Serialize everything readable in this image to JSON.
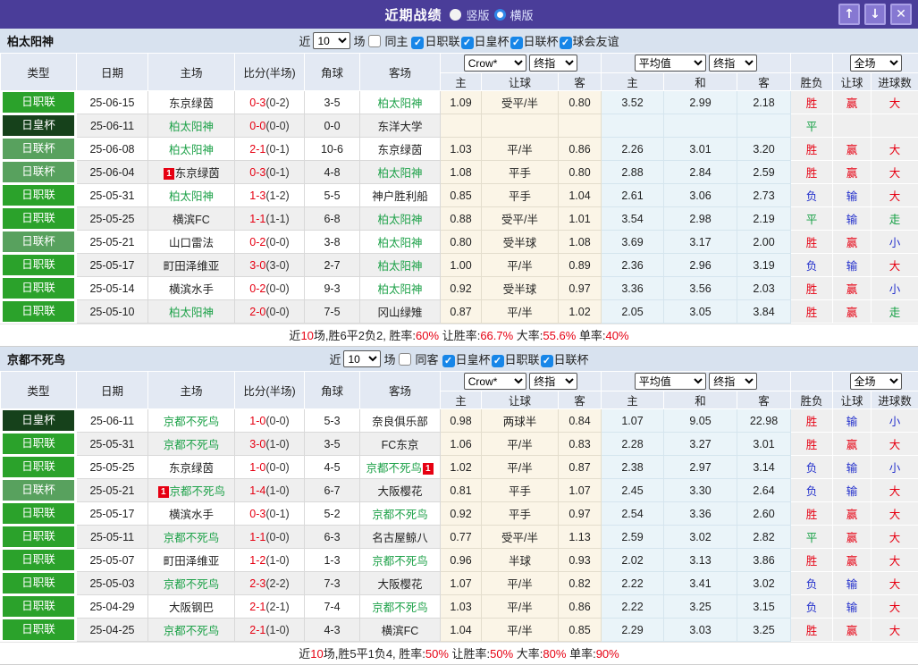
{
  "titlebar": {
    "title": "近期战绩",
    "radios": [
      {
        "label": "竖版",
        "selected": false
      },
      {
        "label": "横版",
        "selected": true
      }
    ],
    "buttons": [
      {
        "name": "scroll-up",
        "glyph": "↑"
      },
      {
        "name": "scroll-down",
        "glyph": "↓"
      },
      {
        "name": "close",
        "glyph": "✕"
      }
    ]
  },
  "table_header": {
    "main": [
      "类型",
      "日期",
      "主场",
      "比分(半场)",
      "角球",
      "客场"
    ],
    "sub": [
      "主",
      "让球",
      "客",
      "主",
      "和",
      "客",
      "胜负",
      "让球",
      "进球数"
    ],
    "selects": {
      "company": "Crow*",
      "company_time": "终指",
      "average": "平均值",
      "average_time": "终指",
      "fulltime": "全场"
    }
  },
  "colors": {
    "titlebar_bg": "#4a3d99",
    "red": "#e60012",
    "blue": "#2330cc",
    "green": "#0f9d3f",
    "team_green": "#1fa24a",
    "league_colors": {
      "日职联": "#2ba22b",
      "日皇杯": "#16411b",
      "日联杯": "#58a15e"
    },
    "outcome": {
      "胜": "#e60012",
      "平": "#0f9d3f",
      "负": "#2330cc",
      "赢": "#e60012",
      "输": "#2330cc",
      "大": "#e60012",
      "小": "#2330cc",
      "走": "#0f9d3f"
    }
  },
  "sections": [
    {
      "team": "柏太阳神",
      "filter": {
        "near_label": "近",
        "count": "10",
        "unit": "场",
        "same_label": "同主",
        "same_checked": false,
        "leagues": [
          {
            "label": "日职联",
            "checked": true
          },
          {
            "label": "日皇杯",
            "checked": true
          },
          {
            "label": "日联杯",
            "checked": true
          },
          {
            "label": "球会友谊",
            "checked": true
          }
        ]
      },
      "rows": [
        {
          "type": "日职联",
          "date": "25-06-15",
          "home": {
            "name": "东京绿茵"
          },
          "score": "0-3",
          "half": "(0-2)",
          "corner": "3-5",
          "away": {
            "name": "柏太阳神",
            "green": true
          },
          "odds": [
            "1.09",
            "受平/半",
            "0.80"
          ],
          "avg": [
            "3.52",
            "2.99",
            "2.18"
          ],
          "result": "胜",
          "handicap": "赢",
          "goal": "大"
        },
        {
          "type": "日皇杯",
          "date": "25-06-11",
          "home": {
            "name": "柏太阳神",
            "green": true
          },
          "score": "0-0",
          "half": "(0-0)",
          "corner": "0-0",
          "away": {
            "name": "东洋大学"
          },
          "odds": [
            "",
            "",
            ""
          ],
          "avg": [
            "",
            "",
            ""
          ],
          "result": "平",
          "handicap": "",
          "goal": ""
        },
        {
          "type": "日联杯",
          "date": "25-06-08",
          "home": {
            "name": "柏太阳神",
            "green": true
          },
          "score": "2-1",
          "half": "(0-1)",
          "corner": "10-6",
          "away": {
            "name": "东京绿茵"
          },
          "odds": [
            "1.03",
            "平/半",
            "0.86"
          ],
          "avg": [
            "2.26",
            "3.01",
            "3.20"
          ],
          "result": "胜",
          "handicap": "赢",
          "goal": "大"
        },
        {
          "type": "日联杯",
          "date": "25-06-04",
          "home": {
            "name": "东京绿茵",
            "badge": "1",
            "badge_side": "left"
          },
          "score": "0-3",
          "half": "(0-1)",
          "corner": "4-8",
          "away": {
            "name": "柏太阳神",
            "green": true
          },
          "odds": [
            "1.08",
            "平手",
            "0.80"
          ],
          "avg": [
            "2.88",
            "2.84",
            "2.59"
          ],
          "result": "胜",
          "handicap": "赢",
          "goal": "大"
        },
        {
          "type": "日职联",
          "date": "25-05-31",
          "home": {
            "name": "柏太阳神",
            "green": true
          },
          "score": "1-3",
          "half": "(1-2)",
          "corner": "5-5",
          "away": {
            "name": "神户胜利船"
          },
          "odds": [
            "0.85",
            "平手",
            "1.04"
          ],
          "avg": [
            "2.61",
            "3.06",
            "2.73"
          ],
          "result": "负",
          "handicap": "输",
          "goal": "大"
        },
        {
          "type": "日职联",
          "date": "25-05-25",
          "home": {
            "name": "横滨FC"
          },
          "score": "1-1",
          "half": "(1-1)",
          "corner": "6-8",
          "away": {
            "name": "柏太阳神",
            "green": true
          },
          "odds": [
            "0.88",
            "受平/半",
            "1.01"
          ],
          "avg": [
            "3.54",
            "2.98",
            "2.19"
          ],
          "result": "平",
          "handicap": "输",
          "goal": "走"
        },
        {
          "type": "日联杯",
          "date": "25-05-21",
          "home": {
            "name": "山口雷法"
          },
          "score": "0-2",
          "half": "(0-0)",
          "corner": "3-8",
          "away": {
            "name": "柏太阳神",
            "green": true
          },
          "odds": [
            "0.80",
            "受半球",
            "1.08"
          ],
          "avg": [
            "3.69",
            "3.17",
            "2.00"
          ],
          "result": "胜",
          "handicap": "赢",
          "goal": "小"
        },
        {
          "type": "日职联",
          "date": "25-05-17",
          "home": {
            "name": "町田泽维亚"
          },
          "score": "3-0",
          "half": "(3-0)",
          "corner": "2-7",
          "away": {
            "name": "柏太阳神",
            "green": true
          },
          "odds": [
            "1.00",
            "平/半",
            "0.89"
          ],
          "avg": [
            "2.36",
            "2.96",
            "3.19"
          ],
          "result": "负",
          "handicap": "输",
          "goal": "大"
        },
        {
          "type": "日职联",
          "date": "25-05-14",
          "home": {
            "name": "横滨水手"
          },
          "score": "0-2",
          "half": "(0-0)",
          "corner": "9-3",
          "away": {
            "name": "柏太阳神",
            "green": true
          },
          "odds": [
            "0.92",
            "受半球",
            "0.97"
          ],
          "avg": [
            "3.36",
            "3.56",
            "2.03"
          ],
          "result": "胜",
          "handicap": "赢",
          "goal": "小"
        },
        {
          "type": "日职联",
          "date": "25-05-10",
          "home": {
            "name": "柏太阳神",
            "green": true
          },
          "score": "2-0",
          "half": "(0-0)",
          "corner": "7-5",
          "away": {
            "name": "冈山绿雉"
          },
          "odds": [
            "0.87",
            "平/半",
            "1.02"
          ],
          "avg": [
            "2.05",
            "3.05",
            "3.84"
          ],
          "result": "胜",
          "handicap": "赢",
          "goal": "走"
        }
      ],
      "summary": [
        {
          "t": "近"
        },
        {
          "t": "10",
          "red": true
        },
        {
          "t": "场,胜6平2负2, 胜率:"
        },
        {
          "t": "60%",
          "red": true
        },
        {
          "t": " 让胜率:"
        },
        {
          "t": "66.7%",
          "red": true
        },
        {
          "t": " 大率:"
        },
        {
          "t": "55.6%",
          "red": true
        },
        {
          "t": " 单率:"
        },
        {
          "t": "40%",
          "red": true
        }
      ]
    },
    {
      "team": "京都不死鸟",
      "filter": {
        "near_label": "近",
        "count": "10",
        "unit": "场",
        "same_label": "同客",
        "same_checked": false,
        "leagues": [
          {
            "label": "日皇杯",
            "checked": true
          },
          {
            "label": "日职联",
            "checked": true
          },
          {
            "label": "日联杯",
            "checked": true
          }
        ]
      },
      "rows": [
        {
          "type": "日皇杯",
          "date": "25-06-11",
          "home": {
            "name": "京都不死鸟",
            "green": true
          },
          "score": "1-0",
          "half": "(0-0)",
          "corner": "5-3",
          "away": {
            "name": "奈良俱乐部"
          },
          "odds": [
            "0.98",
            "两球半",
            "0.84"
          ],
          "avg": [
            "1.07",
            "9.05",
            "22.98"
          ],
          "result": "胜",
          "handicap": "输",
          "goal": "小"
        },
        {
          "type": "日职联",
          "date": "25-05-31",
          "home": {
            "name": "京都不死鸟",
            "green": true
          },
          "score": "3-0",
          "half": "(1-0)",
          "corner": "3-5",
          "away": {
            "name": "FC东京"
          },
          "odds": [
            "1.06",
            "平/半",
            "0.83"
          ],
          "avg": [
            "2.28",
            "3.27",
            "3.01"
          ],
          "result": "胜",
          "handicap": "赢",
          "goal": "大"
        },
        {
          "type": "日职联",
          "date": "25-05-25",
          "home": {
            "name": "东京绿茵"
          },
          "score": "1-0",
          "half": "(0-0)",
          "corner": "4-5",
          "away": {
            "name": "京都不死鸟",
            "green": true,
            "badge": "1",
            "badge_side": "right"
          },
          "odds": [
            "1.02",
            "平/半",
            "0.87"
          ],
          "avg": [
            "2.38",
            "2.97",
            "3.14"
          ],
          "result": "负",
          "handicap": "输",
          "goal": "小"
        },
        {
          "type": "日联杯",
          "date": "25-05-21",
          "home": {
            "name": "京都不死鸟",
            "green": true,
            "badge": "1",
            "badge_side": "left"
          },
          "score": "1-4",
          "half": "(1-0)",
          "corner": "6-7",
          "away": {
            "name": "大阪樱花"
          },
          "odds": [
            "0.81",
            "平手",
            "1.07"
          ],
          "avg": [
            "2.45",
            "3.30",
            "2.64"
          ],
          "result": "负",
          "handicap": "输",
          "goal": "大"
        },
        {
          "type": "日职联",
          "date": "25-05-17",
          "home": {
            "name": "横滨水手"
          },
          "score": "0-3",
          "half": "(0-1)",
          "corner": "5-2",
          "away": {
            "name": "京都不死鸟",
            "green": true
          },
          "odds": [
            "0.92",
            "平手",
            "0.97"
          ],
          "avg": [
            "2.54",
            "3.36",
            "2.60"
          ],
          "result": "胜",
          "handicap": "赢",
          "goal": "大"
        },
        {
          "type": "日职联",
          "date": "25-05-11",
          "home": {
            "name": "京都不死鸟",
            "green": true
          },
          "score": "1-1",
          "half": "(0-0)",
          "corner": "6-3",
          "away": {
            "name": "名古屋鲸八"
          },
          "odds": [
            "0.77",
            "受平/半",
            "1.13"
          ],
          "avg": [
            "2.59",
            "3.02",
            "2.82"
          ],
          "result": "平",
          "handicap": "赢",
          "goal": "大"
        },
        {
          "type": "日职联",
          "date": "25-05-07",
          "home": {
            "name": "町田泽维亚"
          },
          "score": "1-2",
          "half": "(1-0)",
          "corner": "1-3",
          "away": {
            "name": "京都不死鸟",
            "green": true
          },
          "odds": [
            "0.96",
            "半球",
            "0.93"
          ],
          "avg": [
            "2.02",
            "3.13",
            "3.86"
          ],
          "result": "胜",
          "handicap": "赢",
          "goal": "大"
        },
        {
          "type": "日职联",
          "date": "25-05-03",
          "home": {
            "name": "京都不死鸟",
            "green": true
          },
          "score": "2-3",
          "half": "(2-2)",
          "corner": "7-3",
          "away": {
            "name": "大阪樱花"
          },
          "odds": [
            "1.07",
            "平/半",
            "0.82"
          ],
          "avg": [
            "2.22",
            "3.41",
            "3.02"
          ],
          "result": "负",
          "handicap": "输",
          "goal": "大"
        },
        {
          "type": "日职联",
          "date": "25-04-29",
          "home": {
            "name": "大阪钢巴"
          },
          "score": "2-1",
          "half": "(2-1)",
          "corner": "7-4",
          "away": {
            "name": "京都不死鸟",
            "green": true
          },
          "odds": [
            "1.03",
            "平/半",
            "0.86"
          ],
          "avg": [
            "2.22",
            "3.25",
            "3.15"
          ],
          "result": "负",
          "handicap": "输",
          "goal": "大"
        },
        {
          "type": "日职联",
          "date": "25-04-25",
          "home": {
            "name": "京都不死鸟",
            "green": true
          },
          "score": "2-1",
          "half": "(1-0)",
          "corner": "4-3",
          "away": {
            "name": "横滨FC"
          },
          "odds": [
            "1.04",
            "平/半",
            "0.85"
          ],
          "avg": [
            "2.29",
            "3.03",
            "3.25"
          ],
          "result": "胜",
          "handicap": "赢",
          "goal": "大"
        }
      ],
      "summary": [
        {
          "t": "近"
        },
        {
          "t": "10",
          "red": true
        },
        {
          "t": "场,胜5平1负4, 胜率:"
        },
        {
          "t": "50%",
          "red": true
        },
        {
          "t": " 让胜率:"
        },
        {
          "t": "50%",
          "red": true
        },
        {
          "t": " 大率:"
        },
        {
          "t": "80%",
          "red": true
        },
        {
          "t": " 单率:"
        },
        {
          "t": "90%",
          "red": true
        }
      ]
    }
  ]
}
